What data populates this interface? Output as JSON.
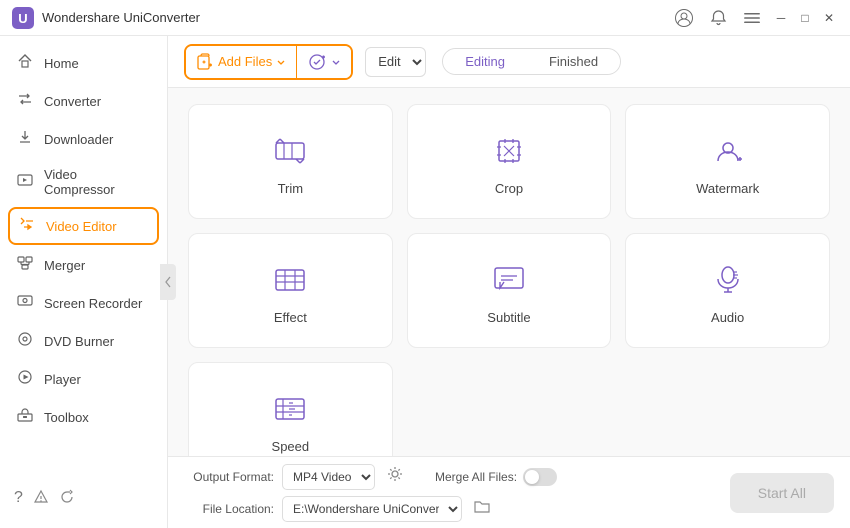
{
  "app": {
    "title": "Wondershare UniConverter",
    "logo_color": "#7c5fc5"
  },
  "titlebar": {
    "account_icon": "👤",
    "bell_icon": "🔔",
    "menu_icon": "☰",
    "minimize": "─",
    "maximize": "□",
    "close": "✕"
  },
  "sidebar": {
    "items": [
      {
        "id": "home",
        "label": "Home",
        "icon": "⌂"
      },
      {
        "id": "converter",
        "label": "Converter",
        "icon": "⇄"
      },
      {
        "id": "downloader",
        "label": "Downloader",
        "icon": "↓"
      },
      {
        "id": "video-compressor",
        "label": "Video Compressor",
        "icon": "⊡"
      },
      {
        "id": "video-editor",
        "label": "Video Editor",
        "icon": "✦",
        "active": true
      },
      {
        "id": "merger",
        "label": "Merger",
        "icon": "⊞"
      },
      {
        "id": "screen-recorder",
        "label": "Screen Recorder",
        "icon": "⊡"
      },
      {
        "id": "dvd-burner",
        "label": "DVD Burner",
        "icon": "⊙"
      },
      {
        "id": "player",
        "label": "Player",
        "icon": "▷"
      },
      {
        "id": "toolbox",
        "label": "Toolbox",
        "icon": "⊞"
      }
    ],
    "bottom_icons": [
      "?",
      "🔔",
      "↺"
    ]
  },
  "toolbar": {
    "add_file_label": "Add Files",
    "add_folder_label": "",
    "edit_dropdown": "Edit",
    "tab_editing": "Editing",
    "tab_finished": "Finished"
  },
  "editor_cards": [
    {
      "id": "trim",
      "label": "Trim"
    },
    {
      "id": "crop",
      "label": "Crop"
    },
    {
      "id": "watermark",
      "label": "Watermark"
    },
    {
      "id": "effect",
      "label": "Effect"
    },
    {
      "id": "subtitle",
      "label": "Subtitle"
    },
    {
      "id": "audio",
      "label": "Audio"
    },
    {
      "id": "speed",
      "label": "Speed"
    }
  ],
  "bottom_bar": {
    "output_format_label": "Output Format:",
    "output_format_value": "MP4 Video",
    "file_location_label": "File Location:",
    "file_location_value": "E:\\Wondershare UniConverter",
    "merge_all_label": "Merge All Files:",
    "start_all_label": "Start All"
  }
}
